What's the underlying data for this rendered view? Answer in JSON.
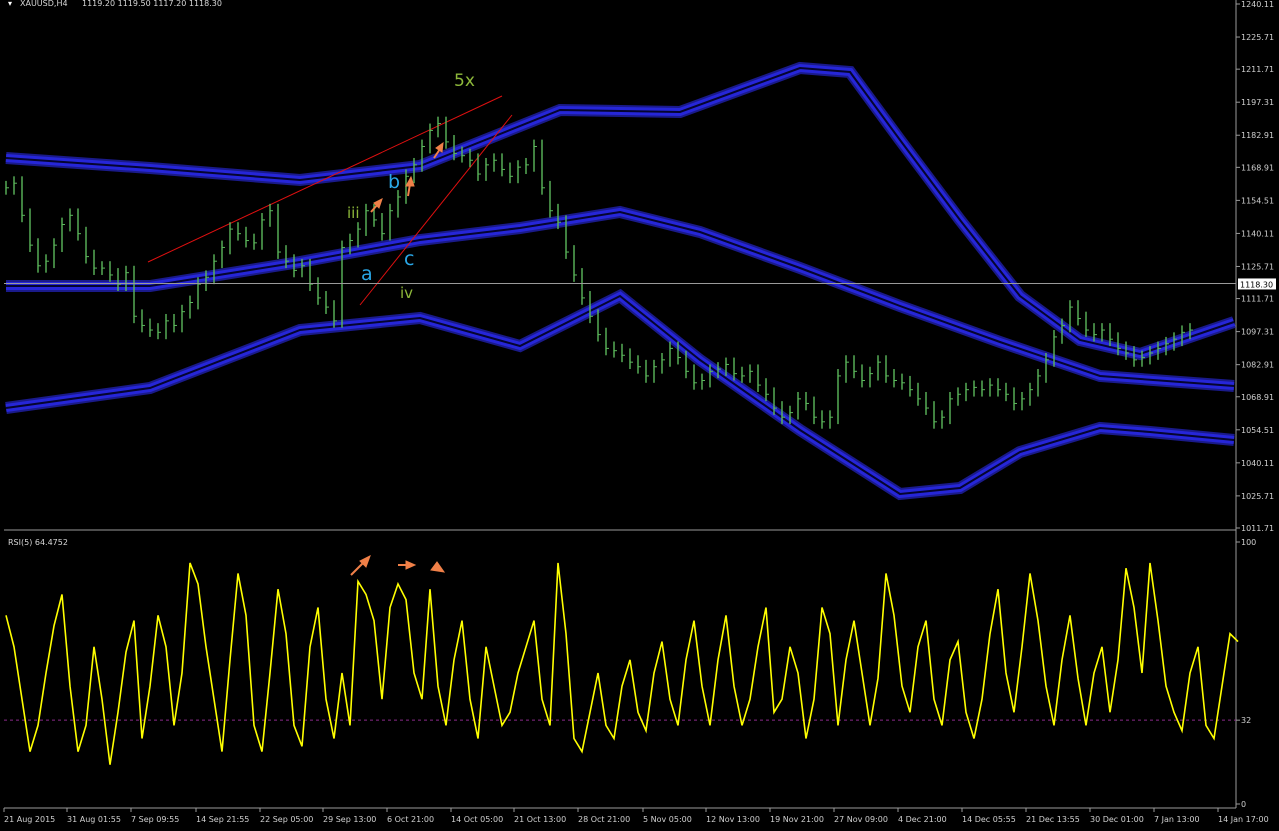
{
  "header": {
    "symbol": "XAUUSD,H4",
    "ohlc": "1119.20 1119.50 1117.20 1118.30"
  },
  "rsi_header": "RSI(5) 64.4752",
  "chart_data": [
    {
      "type": "line",
      "title": "XAUUSD,H4 1119.20 1119.50 1117.20 1118.30",
      "price_axis_ticks": [
        "1240.11",
        "1225.71",
        "1211.71",
        "1197.31",
        "1182.91",
        "1168.91",
        "1154.51",
        "1140.11",
        "1125.71",
        "1111.71",
        "1097.31",
        "1082.91",
        "1068.91",
        "1054.51",
        "1040.11",
        "1025.71",
        "1011.71"
      ],
      "price_tick_values": [
        1240.11,
        1225.71,
        1211.71,
        1197.31,
        1182.91,
        1168.91,
        1154.51,
        1140.11,
        1125.71,
        1111.71,
        1097.31,
        1082.91,
        1068.91,
        1054.51,
        1040.11,
        1025.71,
        1011.71
      ],
      "ylim": [
        1011.71,
        1240.11
      ],
      "current_price": "1118.30",
      "current_price_value": 1118.3,
      "time_labels": [
        "21 Aug 2015",
        "31 Aug 01:55",
        "7 Sep 09:55",
        "14 Sep 21:55",
        "22 Sep 05:00",
        "29 Sep 13:00",
        "6 Oct 21:00",
        "14 Oct 05:00",
        "21 Oct 13:00",
        "28 Oct 21:00",
        "5 Nov 05:00",
        "12 Nov 13:00",
        "19 Nov 21:00",
        "27 Nov 09:00",
        "4 Dec 21:00",
        "14 Dec 05:55",
        "21 Dec 13:55",
        "30 Dec 01:00",
        "7 Jan 13:00",
        "14 Jan 17:00"
      ],
      "price_x": [
        0,
        8,
        16,
        24,
        32,
        40,
        48,
        56,
        64,
        72,
        80,
        88,
        96,
        104,
        112,
        120,
        128,
        136,
        144,
        152,
        160,
        168,
        176,
        184,
        192,
        200,
        208,
        216,
        224,
        232,
        240,
        248,
        256,
        264,
        272,
        280,
        288,
        296,
        304,
        312,
        320,
        328,
        336,
        344,
        352,
        360,
        368,
        376,
        384,
        392,
        400,
        408,
        416,
        424,
        432,
        440,
        448,
        456,
        464,
        472,
        480,
        488,
        496,
        504,
        512,
        520,
        528,
        536,
        544,
        552,
        560,
        568,
        576,
        584,
        592,
        600,
        608,
        616,
        624,
        632,
        640,
        648,
        656,
        664,
        672,
        680,
        688,
        696,
        704,
        712,
        720,
        728,
        736,
        744,
        752,
        760,
        768,
        776,
        784,
        792,
        800,
        808,
        816,
        824,
        832,
        840,
        848,
        856,
        864,
        872,
        880,
        888,
        896,
        904,
        912,
        920,
        928,
        936,
        944,
        952,
        960,
        968,
        976,
        984,
        992,
        1000,
        1008,
        1016,
        1024,
        1032,
        1040,
        1048,
        1056,
        1064,
        1072,
        1080,
        1088,
        1096,
        1104,
        1112,
        1120,
        1128,
        1136,
        1144,
        1152,
        1160,
        1168,
        1176,
        1184,
        1192,
        1200,
        1208,
        1216,
        1224,
        1232
      ],
      "price_values": [
        1160,
        1162,
        1148,
        1135,
        1126,
        1128,
        1135,
        1144,
        1148,
        1140,
        1130,
        1125,
        1125,
        1122,
        1118,
        1123,
        1104,
        1100,
        1098,
        1097,
        1102,
        1100,
        1106,
        1110,
        1118,
        1121,
        1128,
        1134,
        1142,
        1140,
        1137,
        1136,
        1146,
        1150,
        1132,
        1128,
        1124,
        1126,
        1118,
        1112,
        1108,
        1102,
        1134,
        1137,
        1142,
        1150,
        1146,
        1140,
        1150,
        1156,
        1165,
        1170,
        1178,
        1185,
        1188,
        1180,
        1175,
        1174,
        1172,
        1166,
        1170,
        1172,
        1168,
        1165,
        1169,
        1170,
        1178,
        1160,
        1150,
        1145,
        1132,
        1122,
        1112,
        1104,
        1096,
        1090,
        1089,
        1087,
        1084,
        1082,
        1078,
        1082,
        1085,
        1090,
        1086,
        1080,
        1075,
        1076,
        1080,
        1081,
        1083,
        1079,
        1078,
        1080,
        1074,
        1070,
        1064,
        1060,
        1062,
        1068,
        1066,
        1060,
        1058,
        1060,
        1078,
        1084,
        1080,
        1076,
        1079,
        1084,
        1078,
        1076,
        1075,
        1072,
        1068,
        1064,
        1058,
        1060,
        1068,
        1070,
        1072,
        1073,
        1072,
        1074,
        1072,
        1070,
        1066,
        1068,
        1072,
        1078,
        1085,
        1095,
        1100,
        1108,
        1103,
        1098,
        1096,
        1098,
        1094,
        1090,
        1088,
        1085,
        1086,
        1088,
        1090,
        1092,
        1094,
        1097,
        1098
      ],
      "annotations": [
        "5x",
        "b",
        "iii",
        "a",
        "c",
        "iv"
      ]
    },
    {
      "type": "line",
      "title": "RSI(5) 64.4752",
      "rsi_axis_ticks": [
        "100",
        "32",
        "0"
      ],
      "rsi_tick_values": [
        100,
        32,
        0
      ],
      "ylim": [
        0,
        100
      ],
      "level": 32,
      "rsi_x": [
        0,
        8,
        16,
        24,
        32,
        40,
        48,
        56,
        64,
        72,
        80,
        88,
        96,
        104,
        112,
        120,
        128,
        136,
        144,
        152,
        160,
        168,
        176,
        184,
        192,
        200,
        208,
        216,
        224,
        232,
        240,
        248,
        256,
        264,
        272,
        280,
        288,
        296,
        304,
        312,
        320,
        328,
        336,
        344,
        352,
        360,
        368,
        376,
        384,
        392,
        400,
        408,
        416,
        424,
        432,
        440,
        448,
        456,
        464,
        472,
        480,
        488,
        496,
        504,
        512,
        520,
        528,
        536,
        544,
        552,
        560,
        568,
        576,
        584,
        592,
        600,
        608,
        616,
        624,
        632,
        640,
        648,
        656,
        664,
        672,
        680,
        688,
        696,
        704,
        712,
        720,
        728,
        736,
        744,
        752,
        760,
        768,
        776,
        784,
        792,
        800,
        808,
        816,
        824,
        832,
        840,
        848,
        856,
        864,
        872,
        880,
        888,
        896,
        904,
        912,
        920,
        928,
        936,
        944,
        952,
        960,
        968,
        976,
        984,
        992,
        1000,
        1008,
        1016,
        1024,
        1032,
        1040,
        1048,
        1056,
        1064,
        1072,
        1080,
        1088,
        1096,
        1104,
        1112,
        1120,
        1128,
        1136,
        1144,
        1152,
        1160,
        1168,
        1176,
        1184,
        1192,
        1200,
        1208,
        1216,
        1224,
        1232
      ],
      "rsi_values": [
        72,
        60,
        40,
        20,
        30,
        50,
        68,
        80,
        45,
        20,
        30,
        60,
        40,
        15,
        35,
        58,
        70,
        25,
        45,
        72,
        60,
        30,
        50,
        92,
        84,
        60,
        40,
        20,
        55,
        88,
        72,
        30,
        20,
        50,
        82,
        65,
        30,
        22,
        60,
        75,
        40,
        25,
        50,
        30,
        85,
        80,
        70,
        40,
        75,
        84,
        78,
        50,
        40,
        82,
        45,
        30,
        55,
        70,
        40,
        25,
        60,
        45,
        30,
        35,
        50,
        60,
        70,
        40,
        30,
        92,
        65,
        25,
        20,
        35,
        50,
        30,
        25,
        45,
        55,
        35,
        28,
        50,
        62,
        40,
        30,
        55,
        70,
        45,
        30,
        55,
        72,
        45,
        30,
        40,
        60,
        75,
        35,
        40,
        60,
        50,
        25,
        40,
        75,
        65,
        30,
        55,
        70,
        50,
        30,
        48,
        88,
        72,
        45,
        35,
        60,
        70,
        40,
        30,
        55,
        62,
        35,
        25,
        40,
        65,
        82,
        50,
        35,
        60,
        88,
        70,
        45,
        30,
        55,
        72,
        48,
        30,
        50,
        60,
        35,
        55,
        90,
        75,
        50,
        92,
        70,
        45,
        35,
        28,
        50,
        60,
        30,
        25,
        45,
        65,
        62
      ]
    }
  ]
}
